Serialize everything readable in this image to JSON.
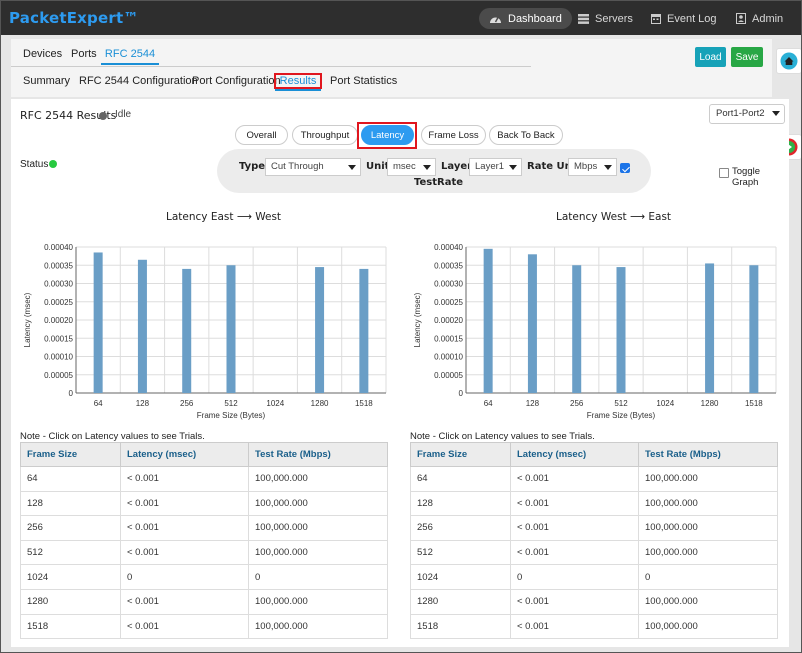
{
  "app": {
    "brand": "PacketExpert™"
  },
  "topnav": [
    {
      "label": "Dashboard",
      "icon": "dashboard-icon",
      "active": true
    },
    {
      "label": "Servers",
      "icon": "servers-icon",
      "active": false
    },
    {
      "label": "Event Log",
      "icon": "calendar-icon",
      "active": false
    },
    {
      "label": "Admin",
      "icon": "user-icon",
      "active": false
    }
  ],
  "tabs1": [
    {
      "label": "Devices"
    },
    {
      "label": "Ports"
    },
    {
      "label": "RFC 2544"
    }
  ],
  "tabs2": [
    {
      "label": "Summary"
    },
    {
      "label": "RFC 2544 Configuration"
    },
    {
      "label": "Port Configuration"
    },
    {
      "label": "Results"
    },
    {
      "label": "Port Statistics"
    }
  ],
  "actions": {
    "load": "Load",
    "save": "Save"
  },
  "results": {
    "title": "RFC 2544 Results",
    "state": "Idle",
    "port_select": "Port1-Port2",
    "status_label": "Status"
  },
  "test_pills": [
    "Overall",
    "Throughput",
    "Latency",
    "Frame Loss",
    "Back To Back"
  ],
  "options": {
    "type_label": "Type",
    "type_value": "Cut Through",
    "unit_label": "Unit",
    "unit_value": "msec",
    "layer_label": "Layer",
    "layer_value": "Layer1",
    "rate_unit_label": "Rate Unit",
    "rate_unit_value": "Mbps",
    "testrate_label": "TestRate",
    "toggle_graph": "Toggle Graph"
  },
  "colors": {
    "bar": "#6a9ec6",
    "accent": "#2d9bf0",
    "highlight": "#e0161e"
  },
  "chart_data": [
    {
      "type": "bar",
      "title": "Latency East ⟶ West",
      "xlabel": "Frame Size (Bytes)",
      "ylabel": "Latency (msec)",
      "categories": [
        "64",
        "128",
        "256",
        "512",
        "1024",
        "1280",
        "1518"
      ],
      "values": [
        0.000385,
        0.000365,
        0.00034,
        0.00035,
        0,
        0.000345,
        0.00034
      ],
      "ylim": [
        0,
        0.0004
      ],
      "yticks": [
        "0",
        "0.00005",
        "0.00010",
        "0.00015",
        "0.00020",
        "0.00025",
        "0.00030",
        "0.00035",
        "0.00040"
      ],
      "grid": true
    },
    {
      "type": "bar",
      "title": "Latency West ⟶ East",
      "xlabel": "Frame Size (Bytes)",
      "ylabel": "Latency (msec)",
      "categories": [
        "64",
        "128",
        "256",
        "512",
        "1024",
        "1280",
        "1518"
      ],
      "values": [
        0.000395,
        0.00038,
        0.00035,
        0.000345,
        0,
        0.000355,
        0.00035
      ],
      "ylim": [
        0,
        0.0004
      ],
      "yticks": [
        "0",
        "0.00005",
        "0.00010",
        "0.00015",
        "0.00020",
        "0.00025",
        "0.00030",
        "0.00035",
        "0.00040"
      ],
      "grid": true
    }
  ],
  "note": "Note - Click on Latency values to see Trials.",
  "table_headers": [
    "Frame Size",
    "Latency (msec)",
    "Test Rate (Mbps)"
  ],
  "table_east": [
    [
      "64",
      "< 0.001",
      "100,000.000"
    ],
    [
      "128",
      "< 0.001",
      "100,000.000"
    ],
    [
      "256",
      "< 0.001",
      "100,000.000"
    ],
    [
      "512",
      "< 0.001",
      "100,000.000"
    ],
    [
      "1024",
      "0",
      "0"
    ],
    [
      "1280",
      "< 0.001",
      "100,000.000"
    ],
    [
      "1518",
      "< 0.001",
      "100,000.000"
    ]
  ],
  "table_west": [
    [
      "64",
      "< 0.001",
      "100,000.000"
    ],
    [
      "128",
      "< 0.001",
      "100,000.000"
    ],
    [
      "256",
      "< 0.001",
      "100,000.000"
    ],
    [
      "512",
      "< 0.001",
      "100,000.000"
    ],
    [
      "1024",
      "0",
      "0"
    ],
    [
      "1280",
      "< 0.001",
      "100,000.000"
    ],
    [
      "1518",
      "< 0.001",
      "100,000.000"
    ]
  ]
}
